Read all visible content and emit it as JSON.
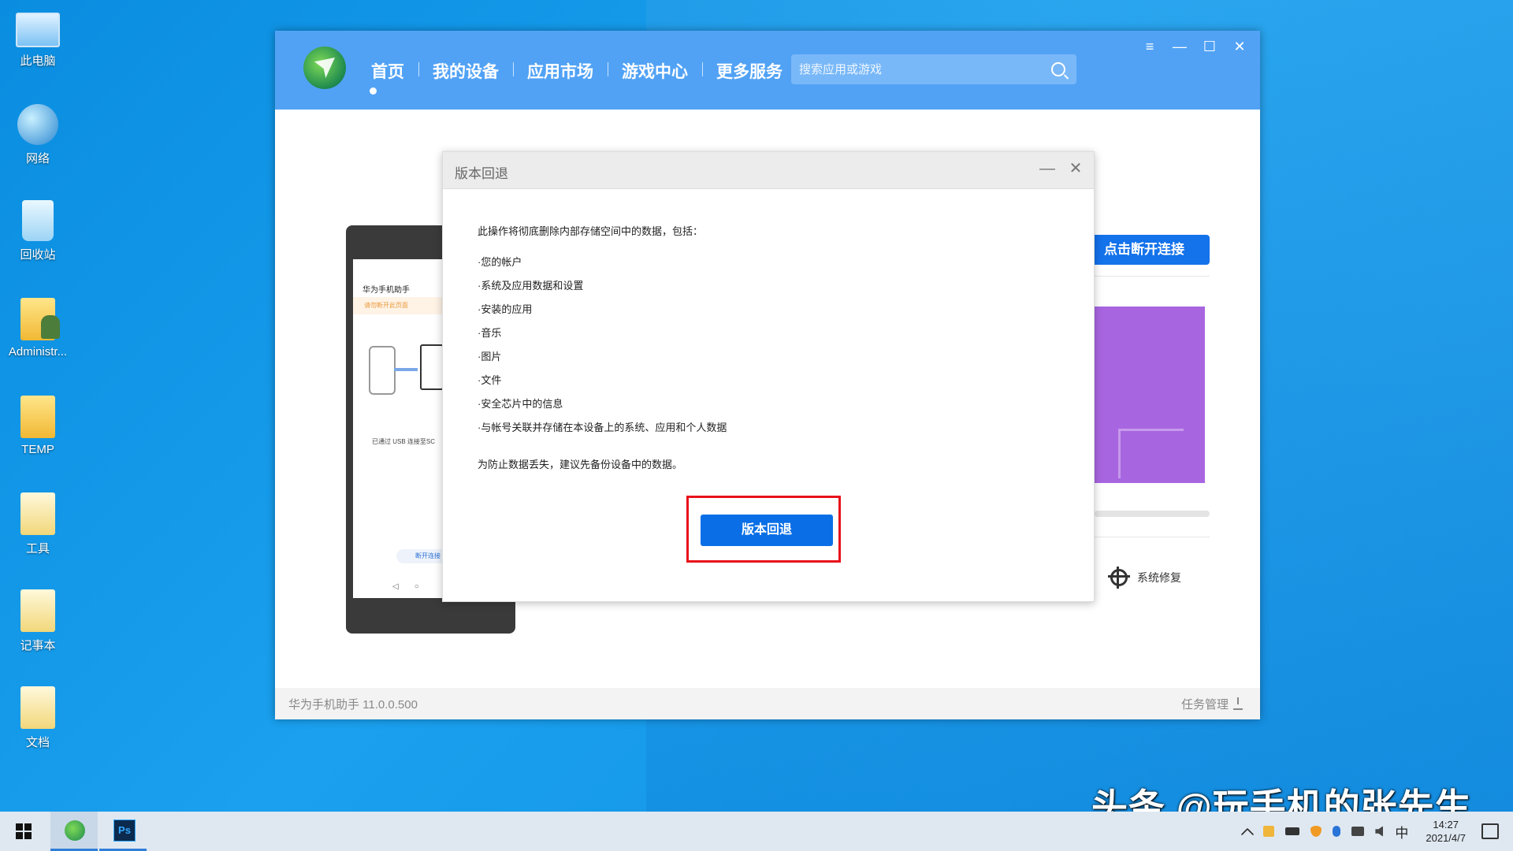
{
  "desktop": {
    "icons": [
      {
        "label": "此电脑",
        "icon": "computer-icon"
      },
      {
        "label": "网络",
        "icon": "network-icon"
      },
      {
        "label": "回收站",
        "icon": "recycle-bin-icon"
      },
      {
        "label": "Administr...",
        "icon": "user-folder-icon"
      },
      {
        "label": "TEMP",
        "icon": "folder-icon"
      },
      {
        "label": "工具",
        "icon": "folder-icon"
      },
      {
        "label": "记事本",
        "icon": "folder-icon"
      },
      {
        "label": "文档",
        "icon": "documents-folder-icon"
      }
    ]
  },
  "app": {
    "nav": [
      "首页",
      "我的设备",
      "应用市场",
      "游戏中心",
      "更多服务"
    ],
    "active_nav": "首页",
    "search_placeholder": "搜索应用或游戏",
    "window_controls": {
      "menu": "≡",
      "minimize": "—",
      "maximize": "☐",
      "close": "✕"
    },
    "disconnect_label": "点击断开连接",
    "repair_label": "系统修复",
    "version": "华为手机助手 11.0.0.500",
    "task_manager": "任务管理",
    "phone": {
      "title": "华为手机助手",
      "warning": "请勿断开此页面",
      "usb_text": "已通过 USB 连接至SC",
      "disconnect_pill": "断开连接"
    }
  },
  "dialog": {
    "title": "版本回退",
    "intro": "此操作将彻底删除内部存储空间中的数据，包括：",
    "items": [
      "·您的帐户",
      "·系统及应用数据和设置",
      "·安装的应用",
      "·音乐",
      "·图片",
      "·文件",
      "·安全芯片中的信息",
      "·与帐号关联并存储在本设备上的系统、应用和个人数据"
    ],
    "advice": "为防止数据丢失，建议先备份设备中的数据。",
    "button": "版本回退",
    "highlight_color": "#e8101a"
  },
  "watermark": "头条 @玩手机的张先生",
  "taskbar": {
    "apps": [
      "huawei-hisuite-icon",
      "photoshop-icon"
    ],
    "ps_label": "Ps",
    "ime": "中",
    "time": "14:27",
    "date": "2021/4/7"
  },
  "colors": {
    "header_blue": "#51a2f5",
    "button_blue": "#0a6fe6",
    "purple_card": "#a865e0"
  }
}
